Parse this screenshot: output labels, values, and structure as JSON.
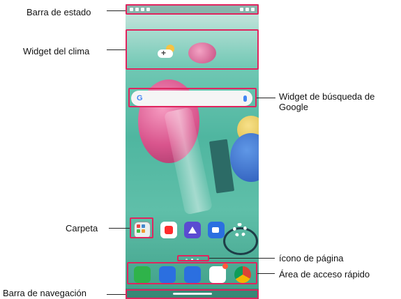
{
  "labels": {
    "status_bar": "Barra de estado",
    "weather_widget": "Widget del clima",
    "search_widget": "Widget de búsqueda de Google",
    "folder": "Carpeta",
    "page_icon": "ícono de página",
    "quick_access": "Área de acceso rápido",
    "nav_bar": "Barra de navegación"
  },
  "search": {
    "logo": "G"
  },
  "weather": {
    "add_symbol": "+"
  },
  "accent_color": "#e0245e",
  "icons": [
    "phone-icon",
    "messages-icon",
    "camera-icon",
    "play-store-icon",
    "chrome-icon",
    "youtube-icon",
    "gallery-icon",
    "video-icon",
    "settings-icon",
    "folder-icon",
    "mic-icon"
  ]
}
